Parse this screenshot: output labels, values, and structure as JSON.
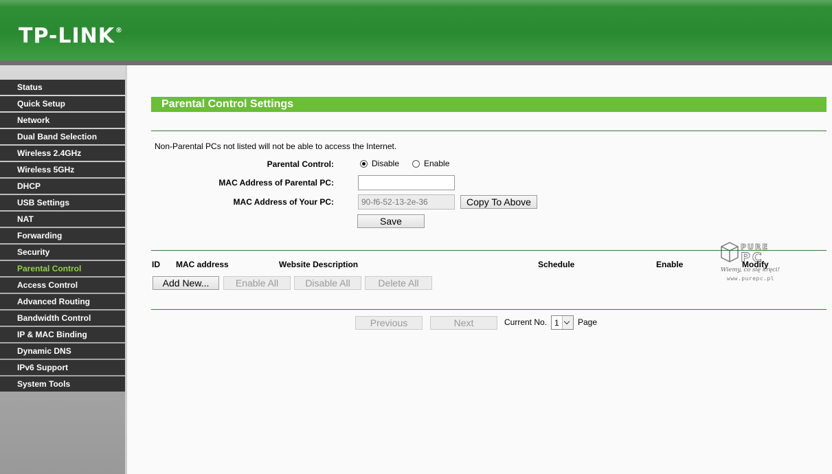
{
  "brand": {
    "logo": "TP-LINK",
    "trademark": "®"
  },
  "sidebar": {
    "items": [
      {
        "label": "Status"
      },
      {
        "label": "Quick Setup"
      },
      {
        "label": "Network"
      },
      {
        "label": "Dual Band Selection"
      },
      {
        "label": "Wireless 2.4GHz"
      },
      {
        "label": "Wireless 5GHz"
      },
      {
        "label": "DHCP"
      },
      {
        "label": "USB Settings"
      },
      {
        "label": "NAT"
      },
      {
        "label": "Forwarding"
      },
      {
        "label": "Security"
      },
      {
        "label": "Parental Control"
      },
      {
        "label": "Access Control"
      },
      {
        "label": "Advanced Routing"
      },
      {
        "label": "Bandwidth Control"
      },
      {
        "label": "IP & MAC Binding"
      },
      {
        "label": "Dynamic DNS"
      },
      {
        "label": "IPv6 Support"
      },
      {
        "label": "System Tools"
      }
    ],
    "active": "Parental Control"
  },
  "main": {
    "title": "Parental Control Settings",
    "note": "Non-Parental PCs not listed will not be able to access the Internet.",
    "form": {
      "parental_control_label": "Parental Control:",
      "disable_label": "Disable",
      "enable_label": "Enable",
      "selected": "Disable",
      "mac_parental_label": "MAC Address of Parental PC:",
      "mac_parental_value": "",
      "mac_your_label": "MAC Address of Your PC:",
      "mac_your_value": "90-f6-52-13-2e-36",
      "copy_button": "Copy To Above",
      "save_button": "Save"
    },
    "table": {
      "columns": [
        "ID",
        "MAC address",
        "Website Description",
        "Schedule",
        "Enable",
        "Modify"
      ],
      "buttons": {
        "add_new": "Add New...",
        "enable_all": "Enable All",
        "disable_all": "Disable All",
        "delete_all": "Delete All"
      }
    },
    "pagination": {
      "previous": "Previous",
      "next": "Next",
      "current_label": "Current No.",
      "current_value": "1",
      "page_label": "Page"
    }
  },
  "watermark": {
    "line1": "PURE",
    "line2": "PC",
    "tagline": "Wiemy, co się kręci!",
    "url": "www.purepc.pl"
  }
}
